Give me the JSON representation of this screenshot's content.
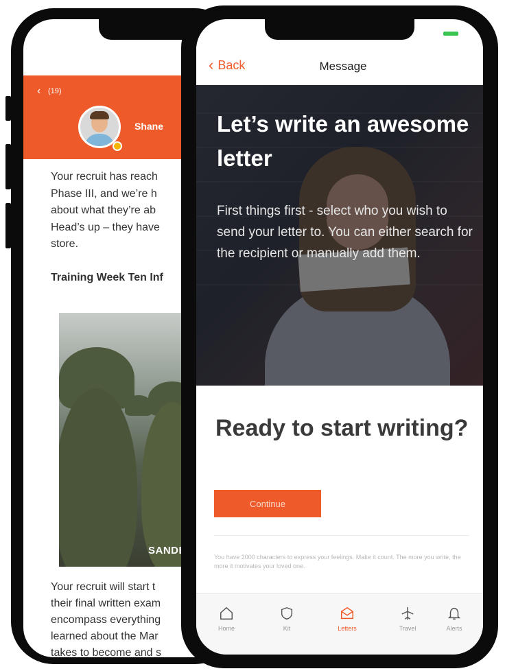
{
  "colors": {
    "accent": "#ef5a2a",
    "active_tab": "#ef5a2a",
    "battery": "#3ac452"
  },
  "back_phone": {
    "header": {
      "back_count": "(19)",
      "sender_name": "Shane"
    },
    "intro_lines": [
      "Your recruit has reach",
      "Phase III, and we’re h",
      "about what they’re ab",
      "Head’s up – they have",
      "store."
    ],
    "section_title": "Training Week Ten Inf",
    "photo_caption": "SANDB",
    "body_lines": [
      "Your recruit will start t",
      "their final written exam",
      "encompass everything",
      "learned about the Mar",
      "takes to become and s"
    ]
  },
  "front_phone": {
    "nav": {
      "back_label": "Back",
      "title": "Message"
    },
    "hero": {
      "title": "Let’s write an awesome letter",
      "body": "First things first - select who you wish to send your letter to. You can either search for the recipient or manually add them."
    },
    "prompt": "Ready to start writing?",
    "continue_label": "Continue",
    "footnote": "You have 2000 characters to express your feelings. Make it count. The more you write, the more it motivates your loved one.",
    "tabs": [
      {
        "label": "Home",
        "icon": "home-icon",
        "active": false
      },
      {
        "label": "Kit",
        "icon": "shield-icon",
        "active": false
      },
      {
        "label": "Letters",
        "icon": "envelope-icon",
        "active": true
      },
      {
        "label": "Travel",
        "icon": "airplane-icon",
        "active": false
      },
      {
        "label": "Alerts",
        "icon": "bell-icon",
        "active": false
      }
    ]
  }
}
